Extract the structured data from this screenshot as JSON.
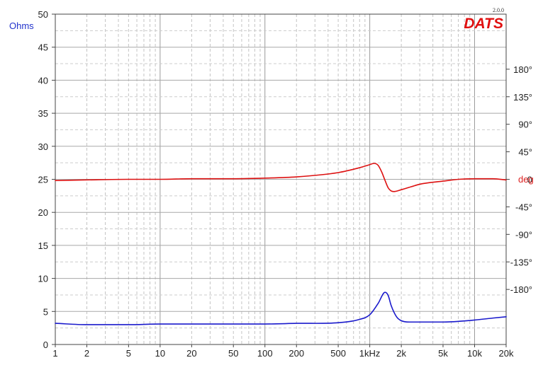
{
  "app": {
    "brand": "DATS",
    "version": "2.0.0"
  },
  "chart_data": {
    "type": "line",
    "x_scale": "log",
    "xlim": [
      1,
      20000
    ],
    "x_ticks": [
      {
        "value": 1,
        "label": "1"
      },
      {
        "value": 2,
        "label": "2"
      },
      {
        "value": 5,
        "label": "5"
      },
      {
        "value": 10,
        "label": "10"
      },
      {
        "value": 20,
        "label": "20"
      },
      {
        "value": 50,
        "label": "50"
      },
      {
        "value": 100,
        "label": "100"
      },
      {
        "value": 200,
        "label": "200"
      },
      {
        "value": 500,
        "label": "500"
      },
      {
        "value": 1000,
        "label": "1kHz"
      },
      {
        "value": 2000,
        "label": "2k"
      },
      {
        "value": 5000,
        "label": "5k"
      },
      {
        "value": 10000,
        "label": "10k"
      },
      {
        "value": 20000,
        "label": "20k"
      }
    ],
    "y_left": {
      "label": "Ohms",
      "ylim": [
        0,
        50
      ],
      "ticks": [
        "0",
        "5",
        "10",
        "15",
        "20",
        "25",
        "30",
        "35",
        "40",
        "45",
        "50"
      ]
    },
    "y_right": {
      "label": "deg",
      "ylim": [
        -270,
        270
      ],
      "ticks": [
        {
          "value": 180,
          "label": "180°"
        },
        {
          "value": 135,
          "label": "135°"
        },
        {
          "value": 90,
          "label": "90°"
        },
        {
          "value": 45,
          "label": "45°"
        },
        {
          "value": 0,
          "label": "0"
        },
        {
          "value": -45,
          "label": "-45°"
        },
        {
          "value": -90,
          "label": "-90°"
        },
        {
          "value": -135,
          "label": "-135°"
        },
        {
          "value": -180,
          "label": "-180°"
        }
      ]
    },
    "grid": true,
    "series": [
      {
        "name": "Ohms",
        "axis": "left",
        "color": "#1a1acc",
        "x": [
          1,
          2,
          5,
          10,
          20,
          50,
          100,
          200,
          500,
          800,
          1000,
          1200,
          1400,
          1500,
          1600,
          1800,
          2000,
          2500,
          3000,
          5000,
          7000,
          10000,
          15000,
          20000
        ],
        "y": [
          3.2,
          3.0,
          3.0,
          3.1,
          3.1,
          3.1,
          3.1,
          3.2,
          3.3,
          3.8,
          4.5,
          6.2,
          7.9,
          7.4,
          5.9,
          4.2,
          3.6,
          3.4,
          3.4,
          3.4,
          3.5,
          3.7,
          4.0,
          4.2
        ]
      },
      {
        "name": "deg",
        "axis": "right",
        "color": "#dd1111",
        "x": [
          1,
          2,
          5,
          10,
          20,
          50,
          100,
          200,
          500,
          800,
          1000,
          1100,
          1200,
          1300,
          1400,
          1500,
          1600,
          1700,
          2000,
          2500,
          3000,
          5000,
          7000,
          10000,
          15000,
          20000
        ],
        "y": [
          -2,
          -1,
          0,
          0,
          1,
          1,
          2,
          4,
          11,
          19,
          24,
          26,
          23,
          12,
          -2,
          -14,
          -19,
          -20,
          -17,
          -12,
          -8,
          -3,
          0,
          1,
          1,
          -1
        ]
      }
    ]
  }
}
